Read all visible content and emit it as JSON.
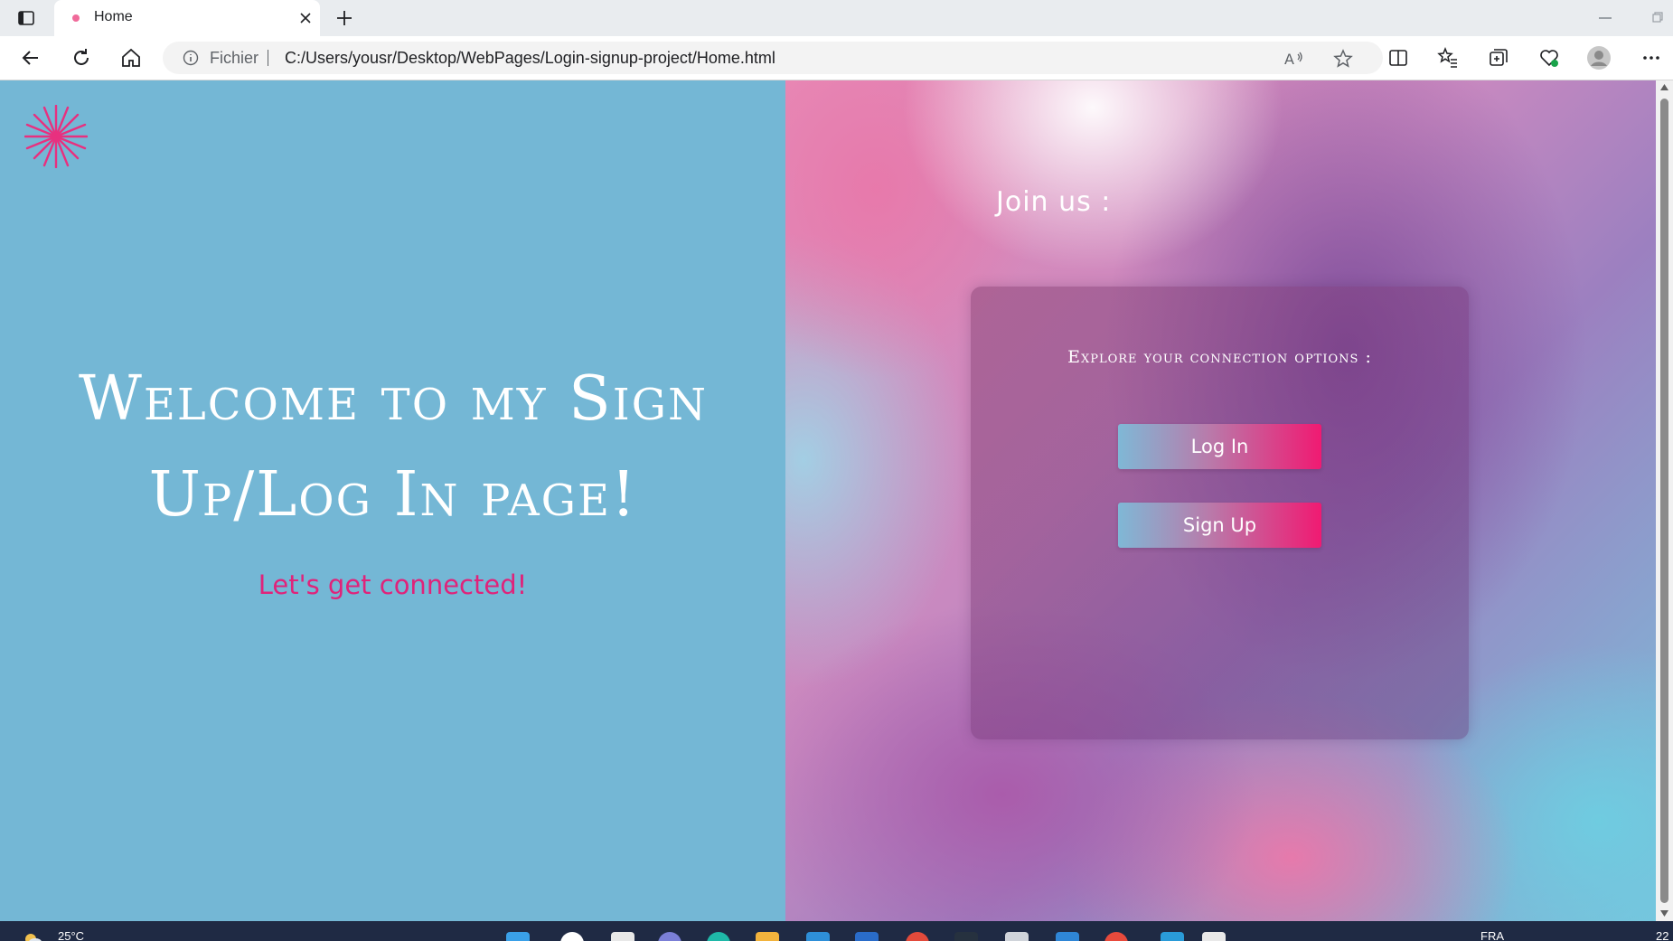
{
  "browser": {
    "tab": {
      "title": "Home",
      "favicon": "pink-dot-favicon-icon"
    },
    "address_bar": {
      "scheme_label": "Fichier",
      "url": "C:/Users/yousr/Desktop/WebPages/Login-signup-project/Home.html"
    },
    "icons": [
      "tab-actions-icon",
      "close-icon",
      "plus-icon",
      "minimize-icon",
      "restore-icon",
      "back-arrow-icon",
      "refresh-icon",
      "home-icon",
      "info-icon",
      "read-aloud-icon",
      "star-icon",
      "split-screen-icon",
      "favorites-icon",
      "collections-icon",
      "browser-essentials-icon",
      "profile-avatar-icon",
      "more-options-icon"
    ]
  },
  "page": {
    "logo": "starburst-logo-icon",
    "welcome_line1": "Welcome to my Sign",
    "welcome_line2": "Up/Log In page!",
    "tagline": "Let's get connected!",
    "join_title": "Join us :",
    "card": {
      "subtitle": "Explore your connection options :",
      "login_button": "Log In",
      "signup_button": "Sign Up"
    }
  },
  "taskbar": {
    "weather": "25°C",
    "language": "FRA",
    "clock": "22"
  },
  "colors": {
    "left_background": "#74b7d5",
    "accent_pink": "#e0237a",
    "button_gradient_end": "#f01a72",
    "logo_color": "#e8307f"
  }
}
